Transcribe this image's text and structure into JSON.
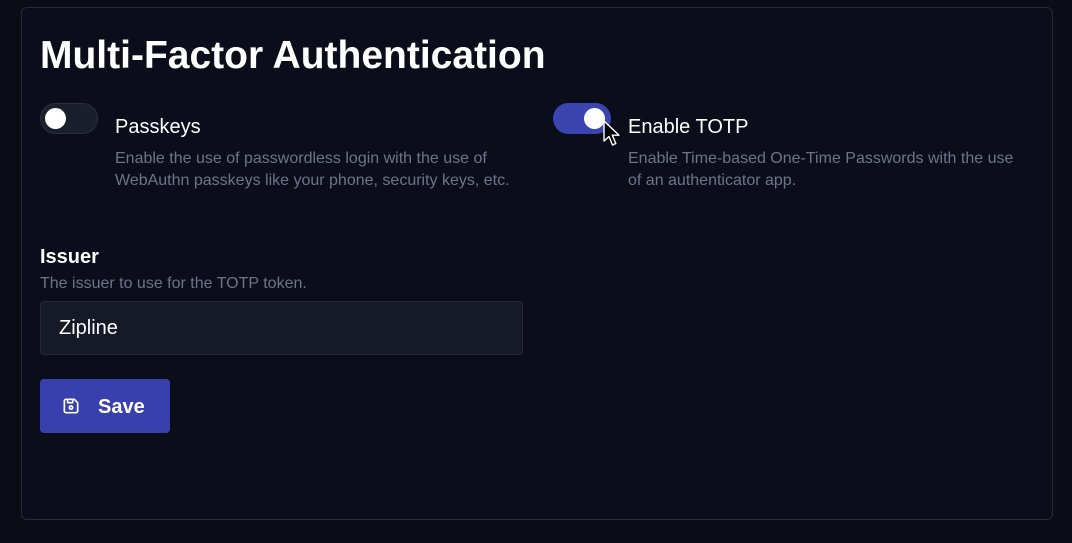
{
  "page": {
    "title": "Multi-Factor Authentication"
  },
  "passkeys": {
    "label": "Passkeys",
    "description": "Enable the use of passwordless login with the use of WebAuthn passkeys like your phone, security keys, etc.",
    "enabled": false
  },
  "totp": {
    "label": "Enable TOTP",
    "description": "Enable Time-based One-Time Passwords with the use of an authenticator app.",
    "enabled": true
  },
  "issuer": {
    "label": "Issuer",
    "description": "The issuer to use for the TOTP token.",
    "value": "Zipline"
  },
  "actions": {
    "save_label": "Save",
    "save_icon": "floppy-disk-icon"
  },
  "colors": {
    "accent": "#3a45b0",
    "background": "#0a0c16",
    "muted_text": "#6e7488"
  }
}
